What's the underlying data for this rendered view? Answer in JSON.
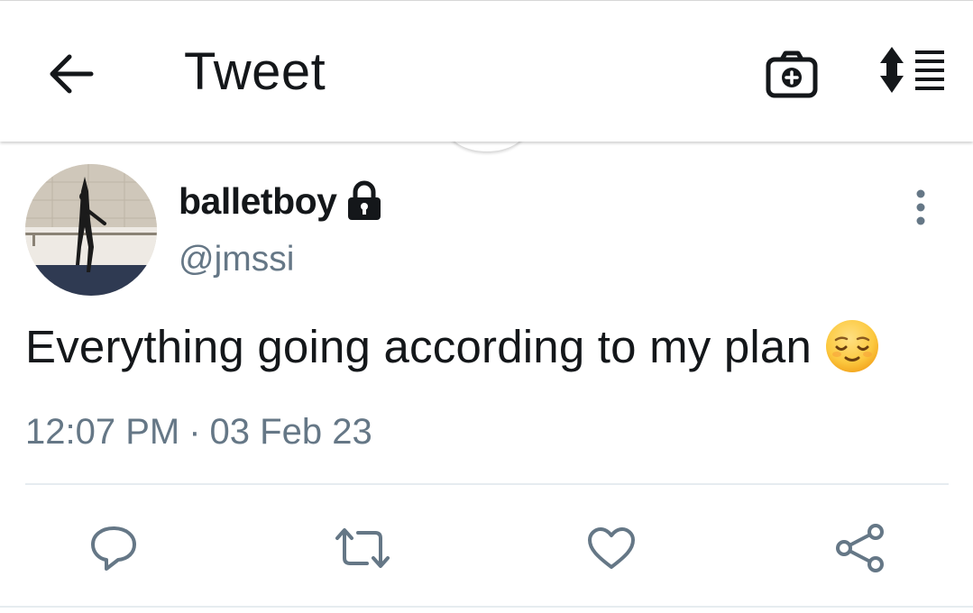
{
  "header": {
    "back_icon": "arrow-left-icon",
    "title": "Tweet",
    "camera_icon": "camera-plus-icon",
    "sort_icon": "sort-list-icon"
  },
  "tweet": {
    "display_name": "balletboy",
    "protected_icon": "lock-icon",
    "handle": "@jmssi",
    "more_icon": "more-vertical-icon",
    "text": "Everything going according to my plan",
    "emoji": "relieved-face-emoji",
    "time": "12:07 PM",
    "separator": "·",
    "date": "03 Feb 23"
  },
  "actions": [
    {
      "icon": "reply-icon"
    },
    {
      "icon": "retweet-icon"
    },
    {
      "icon": "like-icon"
    },
    {
      "icon": "share-icon"
    }
  ],
  "colors": {
    "text_primary": "#14171a",
    "text_secondary": "#657786",
    "divider": "#e6ecf0"
  }
}
